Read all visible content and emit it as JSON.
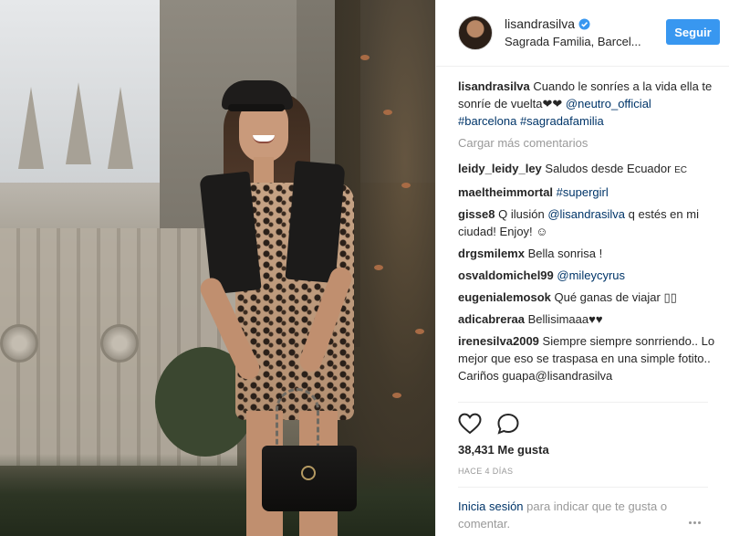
{
  "header": {
    "username": "lisandrasilva",
    "location": "Sagrada Familia, Barcel...",
    "follow_label": "Seguir"
  },
  "caption": {
    "user": "lisandrasilva",
    "text": "Cuando le sonríes a la vida ella te sonríe de vuelta❤❤ ",
    "mention": "@neutro_official",
    "hashtags": "#barcelona #sagradafamilia"
  },
  "load_more_label": "Cargar más comentarios",
  "comments": [
    {
      "user": "leidy_leidy_ley",
      "text": "Saludos desde Ecuador ",
      "tag": "",
      "suffix": "EC"
    },
    {
      "user": "maeltheimmortal",
      "text": "",
      "tag": "#supergirl",
      "suffix": ""
    },
    {
      "user": "gisse8",
      "text": "Q ilusión ",
      "tag": "@lisandrasilva",
      "suffix": " q estés en mi ciudad! Enjoy! ☺"
    },
    {
      "user": "drgsmilemx",
      "text": "Bella sonrisa !",
      "tag": "",
      "suffix": ""
    },
    {
      "user": "osvaldomichel99",
      "text": "",
      "tag": "@mileycyrus",
      "suffix": ""
    },
    {
      "user": "eugenialemosok",
      "text": "Qué ganas de viajar ▯▯",
      "tag": "",
      "suffix": ""
    },
    {
      "user": "adicabreraa",
      "text": "Bellisimaaa♥♥",
      "tag": "",
      "suffix": ""
    },
    {
      "user": "irenesilva2009",
      "text": "Siempre siempre sonrriendo.. Lo mejor que eso se traspasa en una simple fotito.. Cariños guapa@lisandrasilva",
      "tag": "",
      "suffix": ""
    }
  ],
  "likes_label": "38,431 Me gusta",
  "time_label": "HACE 4 DÍAS",
  "login": {
    "link": "Inicia sesión",
    "text": " para indicar que te gusta o comentar."
  },
  "icons": {
    "like": "heart-icon",
    "comment": "comment-bubble-icon",
    "verified": "verified-badge-icon",
    "more": "more-options-icon"
  },
  "colors": {
    "follow_button": "#3897f0",
    "link": "#003569",
    "verified": "#3897f0",
    "muted": "#999999"
  }
}
